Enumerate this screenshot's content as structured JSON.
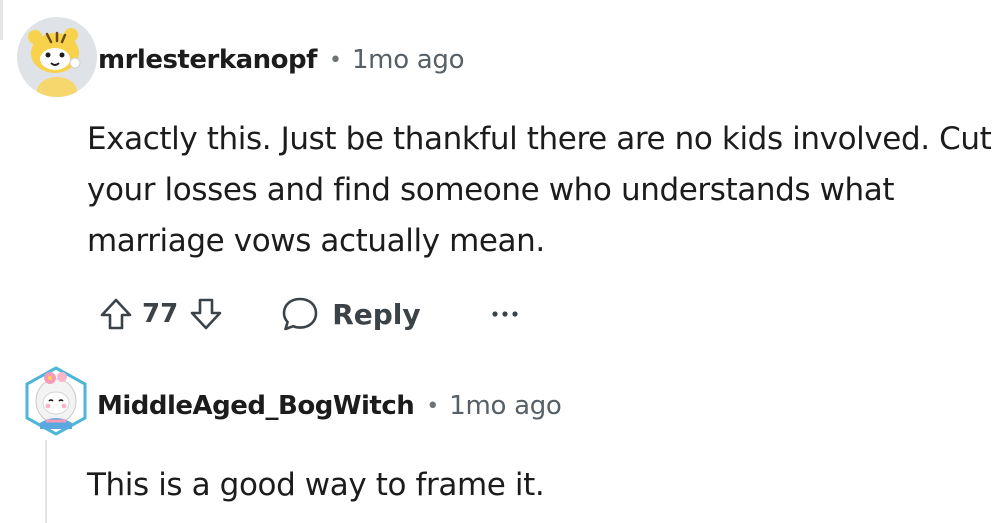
{
  "comments": [
    {
      "username": "mrlesterkanopf",
      "separator": "•",
      "timestamp": "1mo ago",
      "avatar_icon": "tiger-snoo-avatar-icon",
      "body": "Exactly this. Just be thankful there are no kids involved. Cut your losses and find someone who understands what marriage vows actually mean.",
      "votes": "77",
      "reply_label": "Reply",
      "more_label": "•••"
    },
    {
      "username": "MiddleAged_BogWitch",
      "separator": "•",
      "timestamp": "1mo ago",
      "avatar_icon": "flower-snoo-avatar-icon",
      "body": "This is a good way to frame it."
    }
  ],
  "colors": {
    "text": "#1c1c1c",
    "meta": "#576067",
    "icon": "#3b4248"
  }
}
